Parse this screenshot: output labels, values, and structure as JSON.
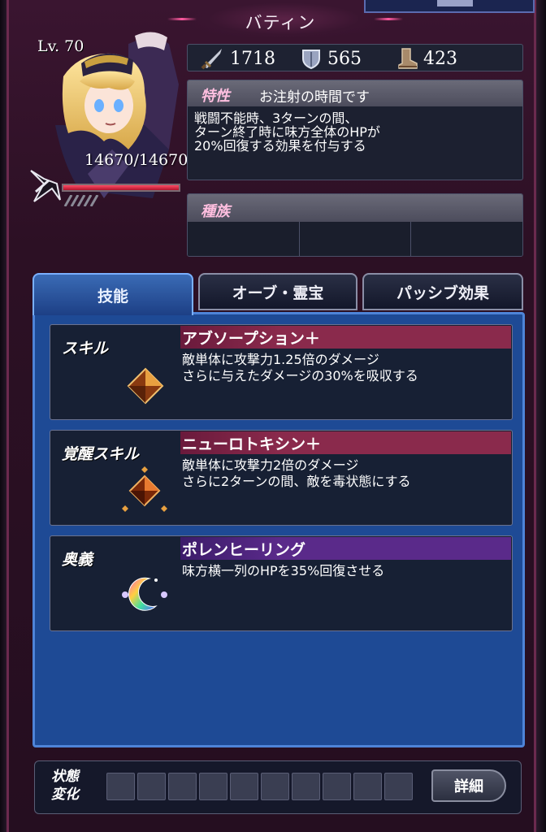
{
  "character": {
    "name": "バティン",
    "level": "Lv. 70",
    "hp": "14670/14670",
    "hp_fraction": 1.0
  },
  "stats": {
    "attack": "1718",
    "defense": "565",
    "speed": "423"
  },
  "trait": {
    "label": "特性",
    "name": "お注射の時間です",
    "description": "戦闘不能時、3ターンの間、\nターン終了時に味方全体のHPが\n20%回復する効果を付与する"
  },
  "race": {
    "label": "種族"
  },
  "tabs": [
    {
      "label": "技能",
      "active": true
    },
    {
      "label": "オーブ・霊宝",
      "active": false
    },
    {
      "label": "パッシブ効果",
      "active": false
    }
  ],
  "skills": [
    {
      "type": "スキル",
      "name": "アブソープション＋",
      "description": "敵単体に攻撃力1.25倍のダメージ\nさらに与えたダメージの30%を吸収する",
      "header_color": "red",
      "icon": "orange-gem-icon"
    },
    {
      "type": "覚醒スキル",
      "name": "ニューロトキシン＋",
      "description": "敵単体に攻撃力2倍のダメージ\nさらに2ターンの間、敵を毒状態にする",
      "header_color": "red",
      "icon": "awakened-gem-icon"
    },
    {
      "type": "奥義",
      "name": "ポレンヒーリング",
      "description": "味方横一列のHPを35%回復させる",
      "header_color": "purple",
      "icon": "rainbow-crescent-icon"
    }
  ],
  "status": {
    "label": "状態\n変化",
    "detail_button": "詳細"
  }
}
